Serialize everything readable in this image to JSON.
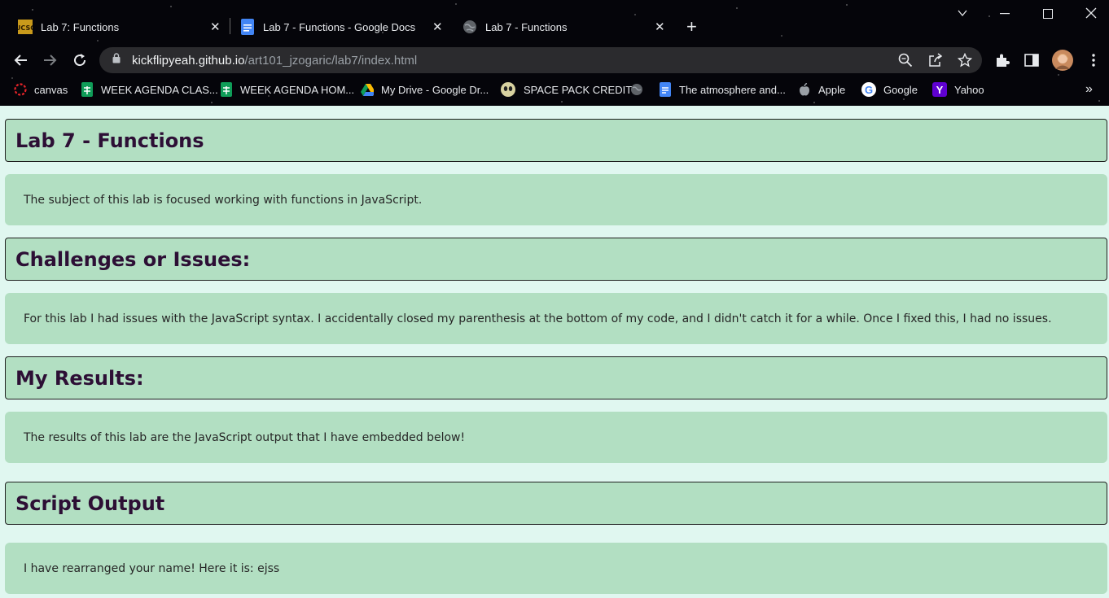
{
  "browser": {
    "tabs": [
      {
        "title": "Lab 7: Functions",
        "favicon": "ucsc-favicon",
        "active": false
      },
      {
        "title": "Lab 7 - Functions - Google Docs",
        "favicon": "google-docs-favicon",
        "active": false
      },
      {
        "title": "Lab 7 - Functions",
        "favicon": "globe-favicon",
        "active": true
      }
    ],
    "new_tab_label": "+",
    "url_host": "kickflipyeah.github.io",
    "url_path": "/art101_jzogaric/lab7/index.html",
    "bookmarks": [
      {
        "label": "canvas",
        "icon": "canvas-icon"
      },
      {
        "label": "WEEK AGENDA CLAS...",
        "icon": "sheets-icon"
      },
      {
        "label": "WEEK AGENDA HOM...",
        "icon": "sheets-icon"
      },
      {
        "label": "My Drive - Google Dr...",
        "icon": "drive-icon"
      },
      {
        "label": "SPACE PACK CREDIT",
        "icon": "alien-icon"
      },
      {
        "label": "",
        "icon": "globe-icon"
      },
      {
        "label": "The atmosphere and...",
        "icon": "docs-icon"
      },
      {
        "label": "Apple",
        "icon": "apple-icon"
      },
      {
        "label": "Google",
        "icon": "google-icon"
      },
      {
        "label": "Yahoo",
        "icon": "yahoo-icon"
      }
    ],
    "overflow_label": "»"
  },
  "page": {
    "title": "Lab 7 - Functions",
    "intro": "The subject of this lab is focused working with functions in JavaScript.",
    "challenges_heading": "Challenges or Issues:",
    "challenges_text": "For this lab I had issues with the JavaScript syntax. I accidentally closed my parenthesis at the bottom of my code, and I didn't catch it for a while. Once I fixed this, I had no issues.",
    "results_heading": "My Results:",
    "results_text": "The results of this lab are the JavaScript output that I have embedded below!",
    "output_heading": "Script Output",
    "output_text": "I have rearranged your name! Here it is: ejss"
  },
  "colors": {
    "page_bg": "#e0f7f0",
    "box_bg": "#b2dfc2",
    "heading": "#2d0f35"
  }
}
